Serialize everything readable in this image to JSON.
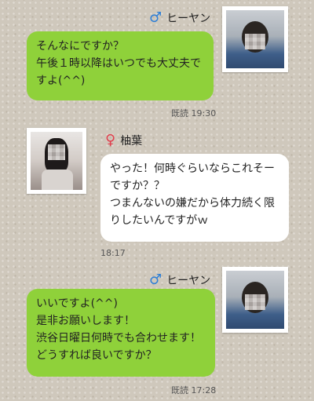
{
  "messages": [
    {
      "sender": "ヒーヤン",
      "gender_icon": "♂",
      "text": "そんなにですか？\n午後１時以降はいつでも大丈夫で\nすよ(^^)",
      "read_label": "既読",
      "time": "19:30"
    },
    {
      "sender": "柚葉",
      "gender_icon": "♀",
      "text": "やった！何時ぐらいならこれそー\nですか？？\nつまんないの嫌だから体力続く限\nりしたいんですがｗ",
      "time": "18:17"
    },
    {
      "sender": "ヒーヤン",
      "gender_icon": "♂",
      "text": "いいですよ(^^)\n是非お願いします！\n渋谷日曜日何時でも合わせます！\nどうすれば良いですか？",
      "read_label": "既読",
      "time": "17:28"
    }
  ],
  "colors": {
    "sent_bubble": "#8fd13a",
    "received_bubble": "#ffffff",
    "male_icon": "#2f7fd6",
    "female_icon": "#e0404e"
  }
}
